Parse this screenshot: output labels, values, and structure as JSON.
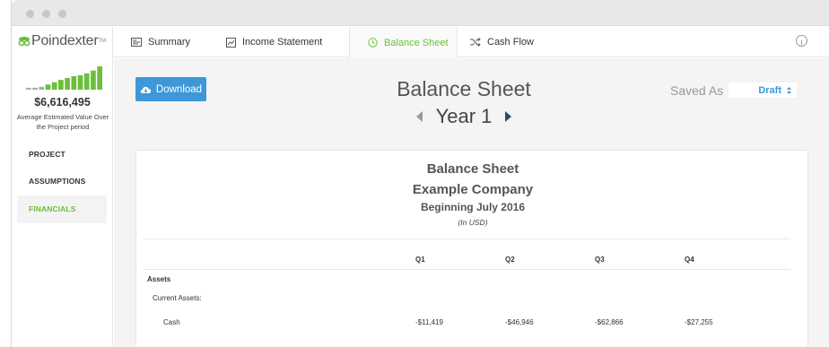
{
  "app": {
    "name": "Poindexter",
    "tm": "TM"
  },
  "sidebar": {
    "summary_value": "$6,616,495",
    "summary_caption": "Average Estimated Value Over the Project period",
    "sparkline": [
      0.08,
      0.08,
      0.12,
      0.22,
      0.32,
      0.42,
      0.5,
      0.58,
      0.62,
      0.7,
      0.82,
      1.0
    ],
    "nav": [
      {
        "label": "PROJECT"
      },
      {
        "label": "ASSUMPTIONS"
      },
      {
        "label": "FINANCIALS"
      }
    ]
  },
  "tabs": [
    {
      "label": "Summary",
      "icon": "summary-icon"
    },
    {
      "label": "Income Statement",
      "icon": "chart-icon"
    },
    {
      "label": "Balance Sheet",
      "icon": "clock-icon"
    },
    {
      "label": "Cash Flow",
      "icon": "shuffle-icon"
    }
  ],
  "toolbar": {
    "download_label": "Download",
    "page_title": "Balance Sheet",
    "period_label": "Year 1",
    "saved_as_label": "Saved As",
    "saved_as_value": "Draft"
  },
  "report": {
    "title": "Balance Sheet",
    "company": "Example Company",
    "period": "Beginning July 2016",
    "units": "(In USD)",
    "columns": [
      "Q1",
      "Q2",
      "Q3",
      "Q4"
    ],
    "section": "Assets",
    "subsection": "Current Assets:",
    "rows": [
      {
        "label": "Cash",
        "values": [
          "-$11,419",
          "-$46,946",
          "-$62,866",
          "-$27,255"
        ]
      }
    ]
  },
  "colors": {
    "accent_green": "#6cbf3a",
    "accent_blue": "#3d97d9"
  }
}
